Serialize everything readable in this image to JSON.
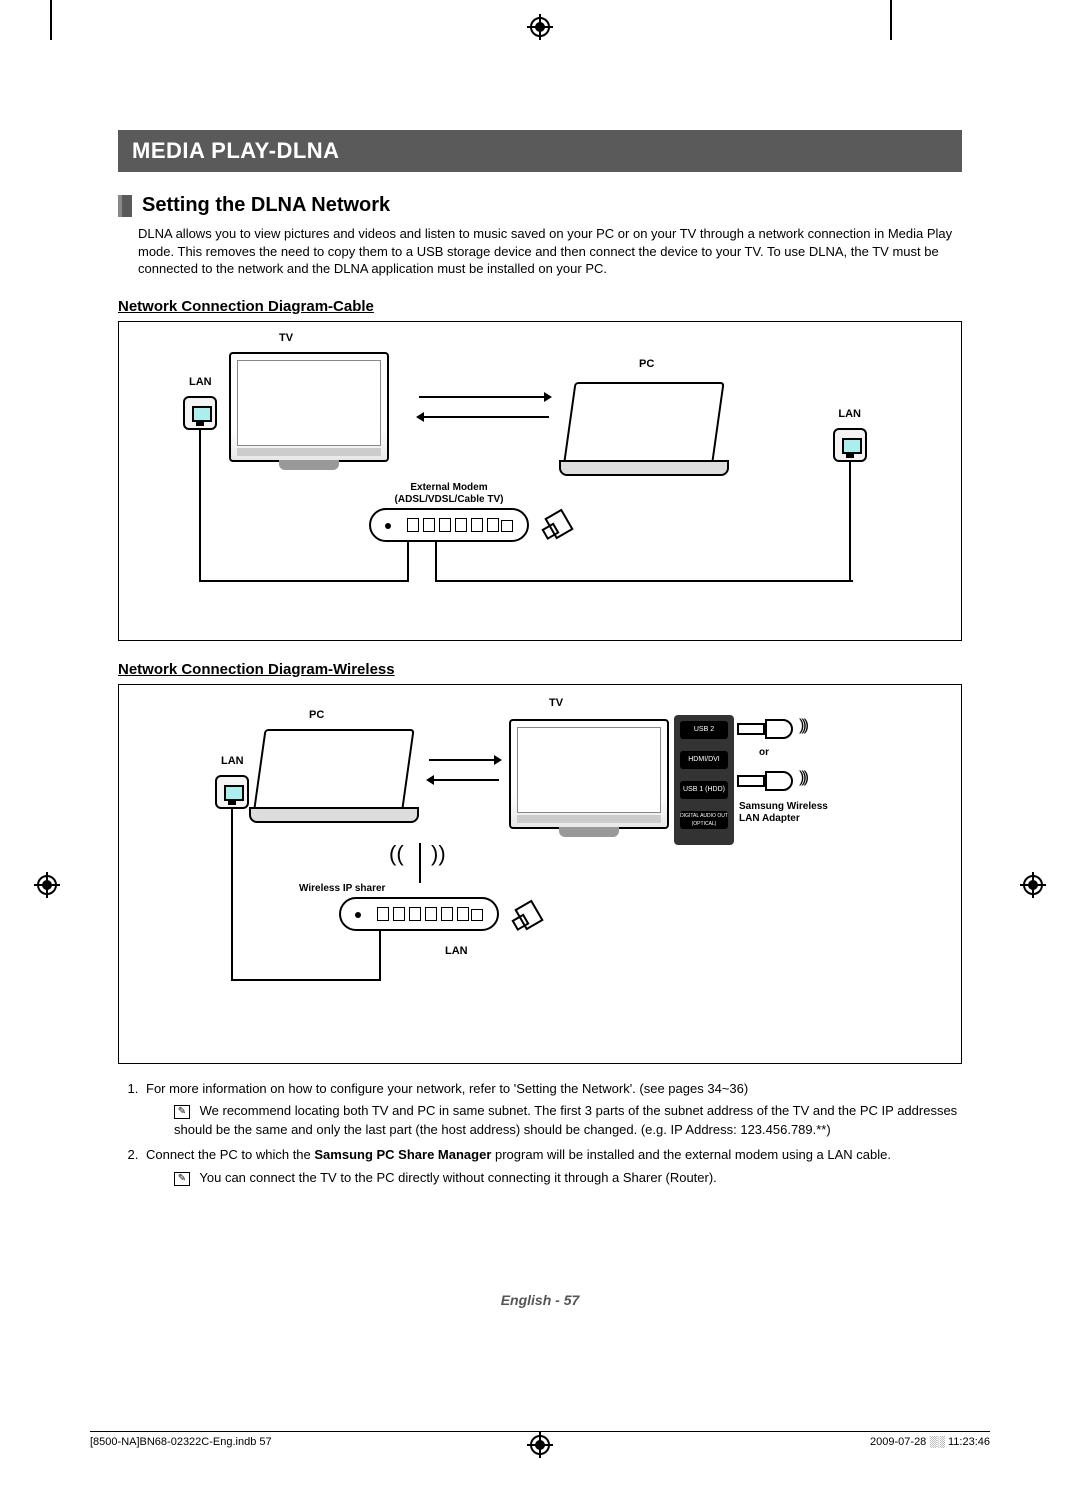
{
  "header": {
    "title": "MEDIA PLAY-DLNA"
  },
  "section": {
    "title": "Setting the DLNA Network"
  },
  "intro": "DLNA allows you to view pictures and videos and listen to music saved on your PC or on your TV through a network connection in Media Play mode. This removes the need to copy them to a USB storage device and then connect the device to your TV. To use DLNA, the TV must be connected to the network and the DLNA application must be installed on your PC.",
  "sub1": "Network Connection Diagram-Cable",
  "sub2": "Network Connection Diagram-Wireless",
  "d1": {
    "tv": "TV",
    "pc": "PC",
    "lan": "LAN",
    "modem1": "External Modem",
    "modem2": "(ADSL/VDSL/Cable TV)"
  },
  "d2": {
    "tv": "TV",
    "pc": "PC",
    "lan": "LAN",
    "sharer": "Wireless IP sharer",
    "or": "or",
    "wlan1": "Samsung Wireless",
    "wlan2": "LAN Adapter",
    "usb2": "USB 2",
    "hdmi": "HDMI/DVI",
    "usb1": "USB 1 (HDD)",
    "opt": "DIGITAL AUDIO OUT (OPTICAL)"
  },
  "note1a": "For more information on how to configure your network, refer to 'Setting the Network'. (see pages 34~36)",
  "note1b": "We recommend locating both TV and PC in same subnet. The first 3 parts of the subnet address of the TV and the PC IP addresses should be the same and only the last part (the host address) should be changed. (e.g. IP Address: 123.456.789.**)",
  "note2a_pre": "Connect the PC to which the ",
  "note2a_bold": "Samsung PC Share Manager",
  "note2a_post": " program will be installed and the external modem using a LAN cable.",
  "note2b": "You can connect the TV to the PC directly without connecting it through a Sharer (Router).",
  "footer": "English - 57",
  "srcfile": "[8500-NA]BN68-02322C-Eng.indb   57",
  "tstamp": "2009-07-28   ░░ 11:23:46"
}
